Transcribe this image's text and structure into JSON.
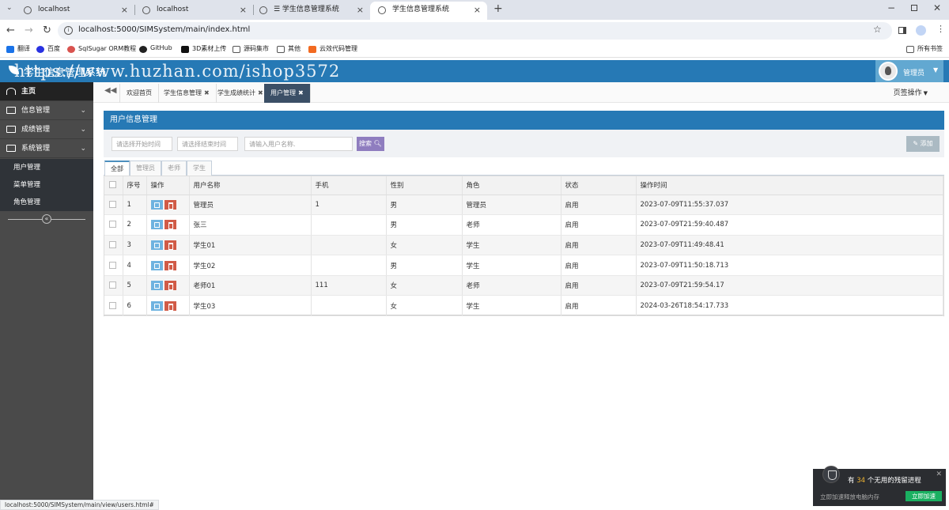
{
  "browser": {
    "tabs": [
      {
        "title": "localhost"
      },
      {
        "title": "localhost"
      },
      {
        "title": "☰ 学生信息管理系统"
      },
      {
        "title": "学生信息管理系统",
        "active": true
      }
    ],
    "url": "localhost:5000/SIMSystem/main/index.html",
    "bookmarks": [
      "翻译",
      "百度",
      "SqlSugar ORM教程",
      "GitHub",
      "3D素材上传",
      "源码集市",
      "其他",
      "云效代码管理"
    ],
    "all_bookmarks": "所有书签",
    "status_url": "localhost:5000/SIMSystem/main/view/users.html#"
  },
  "header": {
    "title": "学生信息管理系统",
    "watermark": "https://www.huzhan.com/ishop3572",
    "user": "管理员"
  },
  "sidebar": {
    "home": "主页",
    "menus": [
      "信息管理",
      "成绩管理",
      "系统管理"
    ],
    "submenus": [
      "用户管理",
      "菜单管理",
      "角色管理"
    ],
    "collapse_icon": "«"
  },
  "page_tabs": [
    {
      "label": "欢迎首页",
      "closable": false
    },
    {
      "label": "学生信息管理",
      "closable": true
    },
    {
      "label": "学生成绩统计",
      "closable": true
    },
    {
      "label": "用户管理",
      "closable": true,
      "active": true
    }
  ],
  "page_ops": "页签操作",
  "panel": {
    "title": "用户信息管理",
    "start_placeholder": "请选择开始时间",
    "end_placeholder": "请选择结束时间",
    "name_placeholder": "请输入用户名称.",
    "search_label": "搜索",
    "add_label": "添加"
  },
  "role_tabs": [
    "全部",
    "管理员",
    "老师",
    "学生"
  ],
  "table": {
    "columns": [
      "序号",
      "操作",
      "用户名称",
      "手机",
      "性别",
      "角色",
      "状态",
      "操作时间"
    ],
    "rows": [
      {
        "no": "1",
        "name": "管理员",
        "phone": "1",
        "gender": "男",
        "role": "管理员",
        "status": "启用",
        "time": "2023-07-09T11:55:37.037"
      },
      {
        "no": "2",
        "name": "张三",
        "phone": "",
        "gender": "男",
        "role": "老师",
        "status": "启用",
        "time": "2023-07-09T21:59:40.487"
      },
      {
        "no": "3",
        "name": "学生01",
        "phone": "",
        "gender": "女",
        "role": "学生",
        "status": "启用",
        "time": "2023-07-09T11:49:48.41"
      },
      {
        "no": "4",
        "name": "学生02",
        "phone": "",
        "gender": "男",
        "role": "学生",
        "status": "启用",
        "time": "2023-07-09T11:50:18.713"
      },
      {
        "no": "5",
        "name": "老师01",
        "phone": "111",
        "gender": "女",
        "role": "老师",
        "status": "启用",
        "time": "2023-07-09T21:59:54.17"
      },
      {
        "no": "6",
        "name": "学生03",
        "phone": "",
        "gender": "女",
        "role": "学生",
        "status": "启用",
        "time": "2024-03-26T18:54:17.733"
      }
    ]
  },
  "popup": {
    "prefix": "有",
    "count": "34",
    "suffix": "个无用的残留进程",
    "sub": "立即加速释放电脑内存",
    "action": "立即加速"
  }
}
